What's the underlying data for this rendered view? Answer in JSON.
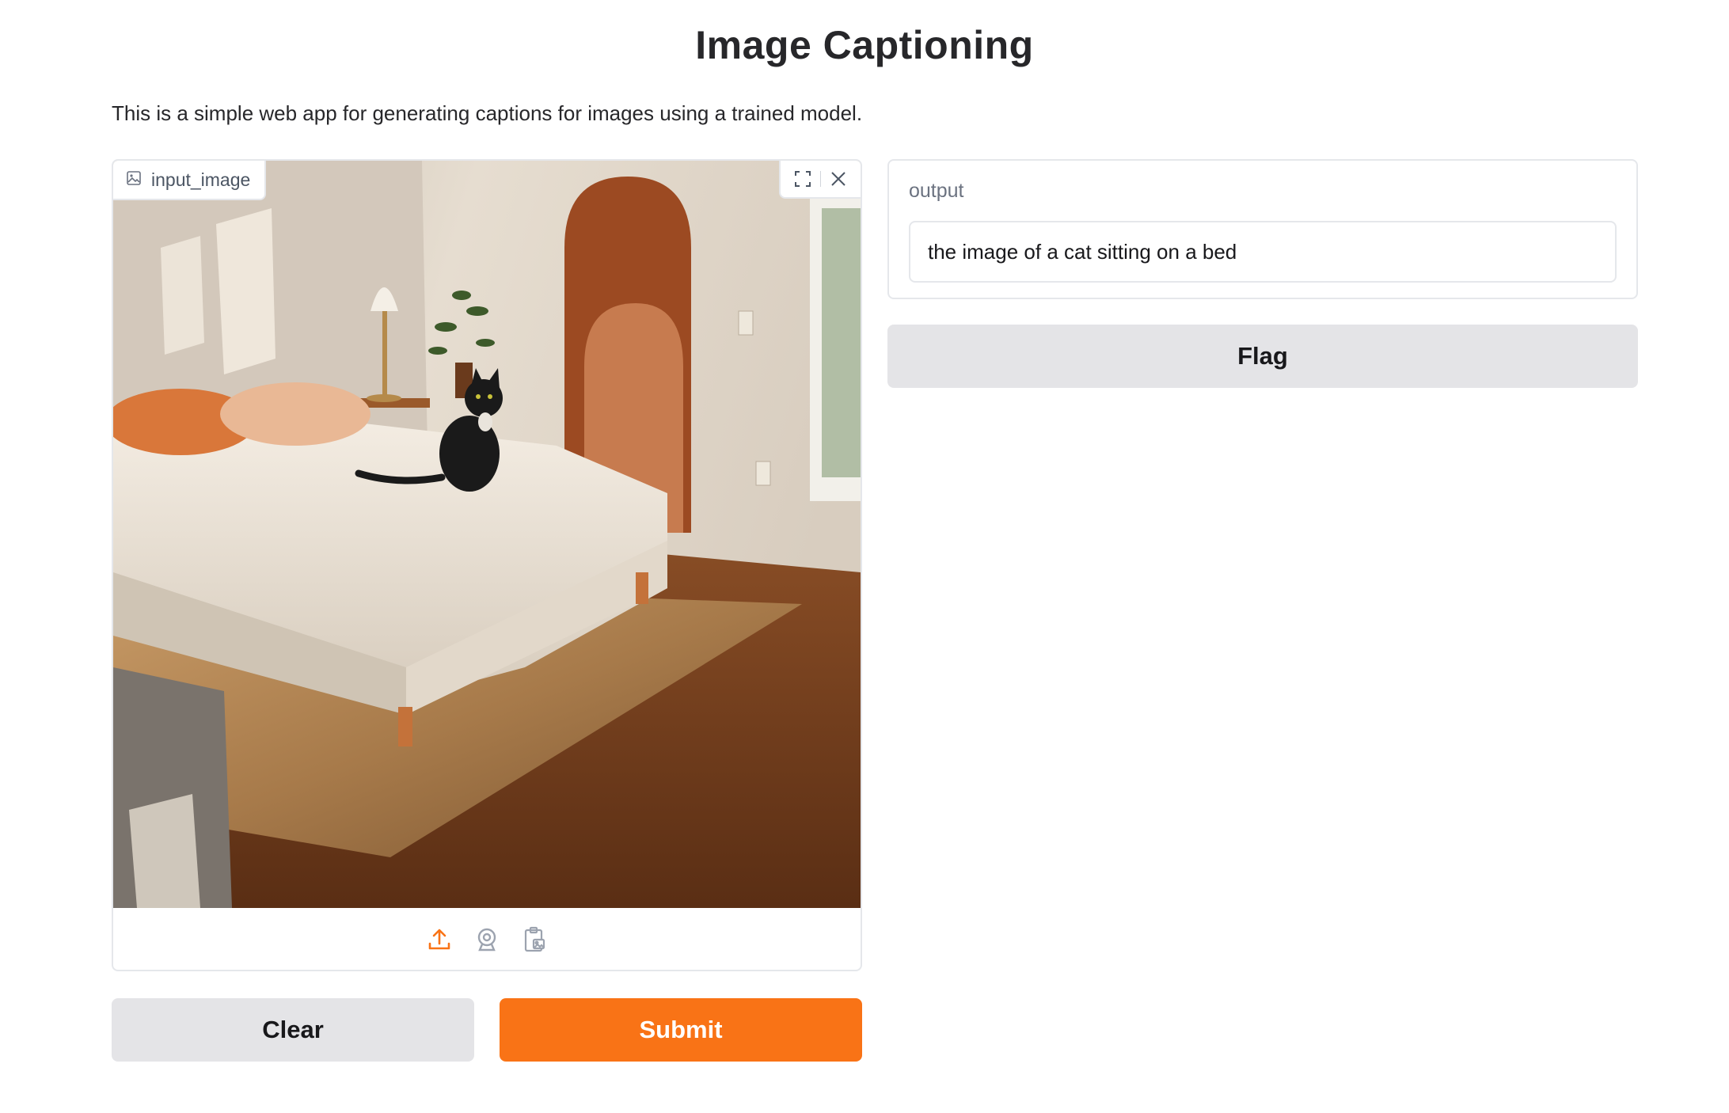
{
  "app": {
    "title": "Image Captioning",
    "description": "This is a simple web app for generating captions for images using a trained model."
  },
  "input": {
    "label": "input_image",
    "tools": [
      "fullscreen-icon",
      "close-icon"
    ],
    "sources": [
      "upload-icon",
      "webcam-icon",
      "clipboard-icon"
    ]
  },
  "output": {
    "label": "output",
    "value": "the image of a cat sitting on a bed"
  },
  "buttons": {
    "clear": "Clear",
    "submit": "Submit",
    "flag": "Flag"
  },
  "colors": {
    "accent": "#f97316",
    "secondary_button": "#e4e4e7",
    "border": "#e5e7eb"
  }
}
